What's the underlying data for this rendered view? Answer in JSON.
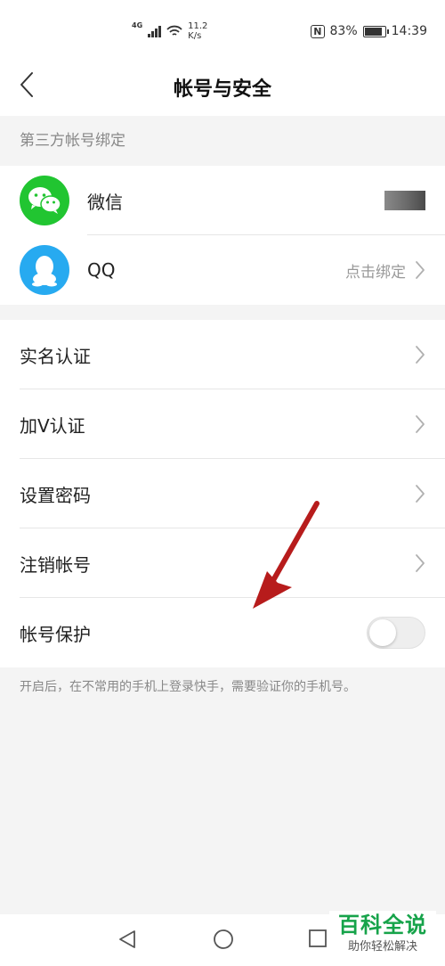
{
  "status_bar": {
    "network": "4G",
    "speed_value": "11.2",
    "speed_unit": "K/s",
    "nfc": "N",
    "battery": "83%",
    "time": "14:39"
  },
  "nav": {
    "title": "帐号与安全"
  },
  "third_party": {
    "header": "第三方帐号绑定",
    "items": [
      {
        "label": "微信",
        "icon": "wechat-icon",
        "status": ""
      },
      {
        "label": "QQ",
        "icon": "qq-icon",
        "status": "点击绑定"
      }
    ]
  },
  "menu": {
    "items": [
      {
        "label": "实名认证"
      },
      {
        "label": "加V认证"
      },
      {
        "label": "设置密码"
      },
      {
        "label": "注销帐号"
      }
    ],
    "protect": {
      "label": "帐号保护",
      "enabled": false
    },
    "hint": "开启后，在不常用的手机上登录快手，需要验证你的手机号。"
  },
  "watermark": {
    "main": "百科全说",
    "sub": "助你轻松解决"
  },
  "colors": {
    "wechat": "#21c531",
    "qq": "#27aaf0",
    "arrow": "#b71c1c",
    "watermark": "#16a34a"
  }
}
